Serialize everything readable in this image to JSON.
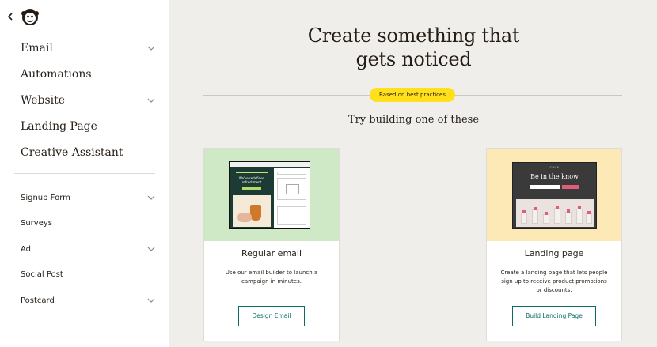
{
  "sidebar": {
    "back_icon": "chevron-left-icon",
    "logo_icon": "mailchimp-freddie-logo",
    "primary_items": [
      {
        "label": "Email",
        "has_chevron": true
      },
      {
        "label": "Automations",
        "has_chevron": false
      },
      {
        "label": "Website",
        "has_chevron": true
      },
      {
        "label": "Landing Page",
        "has_chevron": false
      },
      {
        "label": "Creative Assistant",
        "has_chevron": false
      }
    ],
    "secondary_items": [
      {
        "label": "Signup Form",
        "has_chevron": true
      },
      {
        "label": "Surveys",
        "has_chevron": false
      },
      {
        "label": "Ad",
        "has_chevron": true
      },
      {
        "label": "Social Post",
        "has_chevron": false
      },
      {
        "label": "Postcard",
        "has_chevron": true
      }
    ]
  },
  "main": {
    "title_line1": "Create something that",
    "title_line2": "gets noticed",
    "badge": "Based on best practices",
    "subtitle": "Try building one of these",
    "cards": {
      "email": {
        "title": "Regular email",
        "description": "Use our email builder to launch a campaign in minutes.",
        "button": "Design Email"
      },
      "landing": {
        "title": "Landing page",
        "description": "Create a landing page that lets people sign up to receive product promotions or discounts.",
        "button": "Build Landing Page"
      }
    }
  },
  "previews": {
    "email_headline": "We've redefined refreshment",
    "landing_brand": "CRUX",
    "landing_headline": "Be in the know"
  },
  "colors": {
    "accent_yellow": "#ffe01b",
    "button_teal": "#0a6a6a",
    "email_preview_bg": "#cfe8c5",
    "landing_preview_bg": "#fde9b6",
    "page_bg": "#efeeea"
  }
}
